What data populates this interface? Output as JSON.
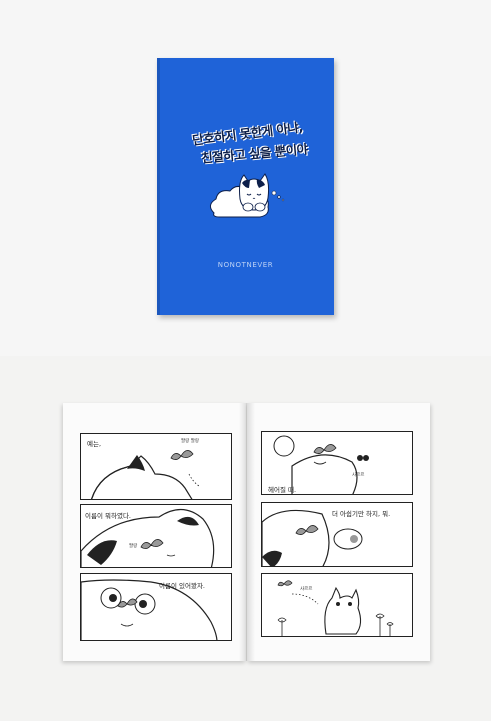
{
  "cover": {
    "title_line1": "단호하지 못한게 아냐,",
    "title_line2": "친절하고 싶을 뿐이야",
    "brand": "NONOTNEVER",
    "color": "#1f63d8"
  },
  "left_page": {
    "panel1_caption": "예는,",
    "panel1_sfx": "팔랑 팔랑",
    "panel2_caption": "이름이 뭐하였다.",
    "panel2_sfx": "팔랑",
    "panel3_caption": "이름이 있어봤자."
  },
  "right_page": {
    "panel1_caption": "헤어질 때.",
    "panel1_sfx": "사르르",
    "panel2_caption": "더 아쉽기만 하지, 뭐.",
    "panel3_sfx": "사르르"
  }
}
